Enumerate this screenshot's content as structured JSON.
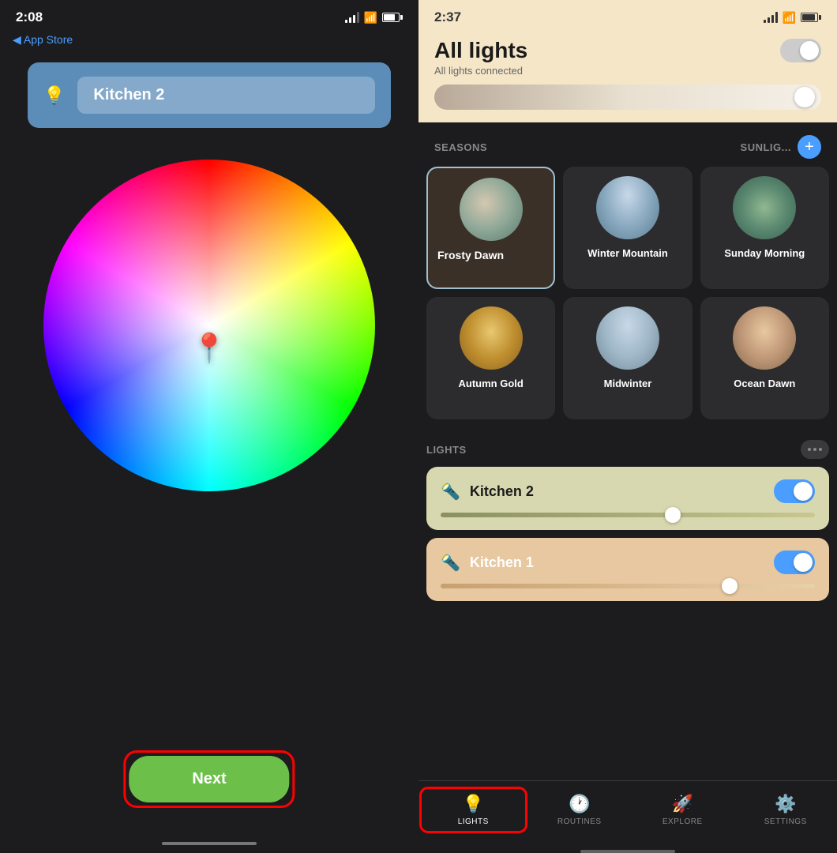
{
  "left": {
    "statusBar": {
      "time": "2:08",
      "backLabel": "◀ App Store"
    },
    "lightName": "Kitchen 2",
    "nextButton": "Next"
  },
  "right": {
    "statusBar": {
      "time": "2:37"
    },
    "header": {
      "title": "All lights",
      "subtitle": "All lights connected"
    },
    "sections": {
      "seasons": "SEASONS",
      "sunlights": "SUNLIG...",
      "lights": "LIGHTS"
    },
    "scenes": [
      {
        "name": "Frosty Dawn",
        "type": "frosty"
      },
      {
        "name": "Winter Mountain",
        "type": "winter"
      },
      {
        "name": "Sunday Morning",
        "type": "sunday"
      },
      {
        "name": "Autumn Gold",
        "type": "autumn"
      },
      {
        "name": "Midwinter",
        "type": "midwinter"
      },
      {
        "name": "Ocean Dawn",
        "type": "ocean"
      }
    ],
    "lightCards": [
      {
        "name": "Kitchen 2",
        "theme": "kitchen2"
      },
      {
        "name": "Kitchen 1",
        "theme": "kitchen1"
      }
    ]
  },
  "nav": {
    "items": [
      {
        "label": "LIGHTS",
        "icon": "💡",
        "active": true
      },
      {
        "label": "ROUTINES",
        "icon": "🕐",
        "active": false
      },
      {
        "label": "EXPLORE",
        "icon": "🚀",
        "active": false
      },
      {
        "label": "SETTINGS",
        "icon": "⚙️",
        "active": false
      }
    ]
  }
}
